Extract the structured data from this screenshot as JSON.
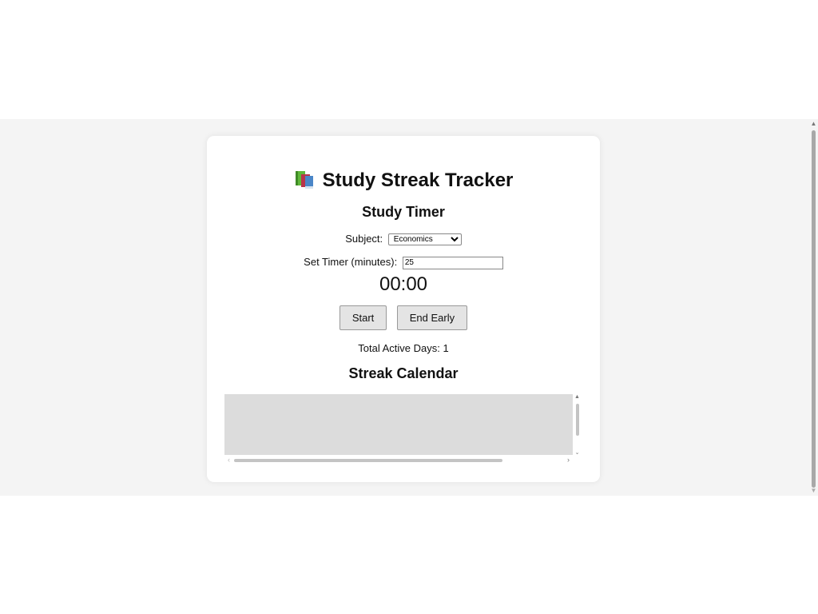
{
  "app": {
    "title": "Study Streak Tracker",
    "title_icon": "books-icon"
  },
  "timer_section": {
    "heading": "Study Timer",
    "subject_label": "Subject:",
    "subject_selected": "Economics",
    "minutes_label": "Set Timer (minutes):",
    "minutes_value": "25",
    "display": "00:00",
    "start_label": "Start",
    "end_label": "End Early"
  },
  "stats": {
    "total_active_days": "Total Active Days: 1"
  },
  "calendar_section": {
    "heading": "Streak Calendar"
  },
  "colors": {
    "page_bg": "#f4f4f4",
    "card_bg": "#ffffff",
    "calendar_bg": "#dcdcdc",
    "button_bg": "#e4e4e4"
  }
}
